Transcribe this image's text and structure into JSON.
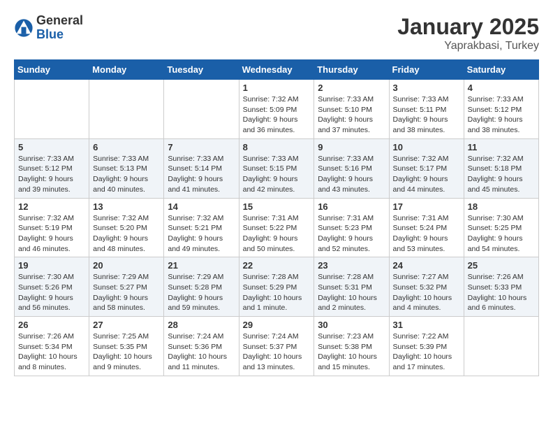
{
  "logo": {
    "general": "General",
    "blue": "Blue"
  },
  "title": "January 2025",
  "subtitle": "Yaprakbasi, Turkey",
  "days_of_week": [
    "Sunday",
    "Monday",
    "Tuesday",
    "Wednesday",
    "Thursday",
    "Friday",
    "Saturday"
  ],
  "weeks": [
    [
      {
        "num": "",
        "info": ""
      },
      {
        "num": "",
        "info": ""
      },
      {
        "num": "",
        "info": ""
      },
      {
        "num": "1",
        "info": "Sunrise: 7:32 AM\nSunset: 5:09 PM\nDaylight: 9 hours and 36 minutes."
      },
      {
        "num": "2",
        "info": "Sunrise: 7:33 AM\nSunset: 5:10 PM\nDaylight: 9 hours and 37 minutes."
      },
      {
        "num": "3",
        "info": "Sunrise: 7:33 AM\nSunset: 5:11 PM\nDaylight: 9 hours and 38 minutes."
      },
      {
        "num": "4",
        "info": "Sunrise: 7:33 AM\nSunset: 5:12 PM\nDaylight: 9 hours and 38 minutes."
      }
    ],
    [
      {
        "num": "5",
        "info": "Sunrise: 7:33 AM\nSunset: 5:12 PM\nDaylight: 9 hours and 39 minutes."
      },
      {
        "num": "6",
        "info": "Sunrise: 7:33 AM\nSunset: 5:13 PM\nDaylight: 9 hours and 40 minutes."
      },
      {
        "num": "7",
        "info": "Sunrise: 7:33 AM\nSunset: 5:14 PM\nDaylight: 9 hours and 41 minutes."
      },
      {
        "num": "8",
        "info": "Sunrise: 7:33 AM\nSunset: 5:15 PM\nDaylight: 9 hours and 42 minutes."
      },
      {
        "num": "9",
        "info": "Sunrise: 7:33 AM\nSunset: 5:16 PM\nDaylight: 9 hours and 43 minutes."
      },
      {
        "num": "10",
        "info": "Sunrise: 7:32 AM\nSunset: 5:17 PM\nDaylight: 9 hours and 44 minutes."
      },
      {
        "num": "11",
        "info": "Sunrise: 7:32 AM\nSunset: 5:18 PM\nDaylight: 9 hours and 45 minutes."
      }
    ],
    [
      {
        "num": "12",
        "info": "Sunrise: 7:32 AM\nSunset: 5:19 PM\nDaylight: 9 hours and 46 minutes."
      },
      {
        "num": "13",
        "info": "Sunrise: 7:32 AM\nSunset: 5:20 PM\nDaylight: 9 hours and 48 minutes."
      },
      {
        "num": "14",
        "info": "Sunrise: 7:32 AM\nSunset: 5:21 PM\nDaylight: 9 hours and 49 minutes."
      },
      {
        "num": "15",
        "info": "Sunrise: 7:31 AM\nSunset: 5:22 PM\nDaylight: 9 hours and 50 minutes."
      },
      {
        "num": "16",
        "info": "Sunrise: 7:31 AM\nSunset: 5:23 PM\nDaylight: 9 hours and 52 minutes."
      },
      {
        "num": "17",
        "info": "Sunrise: 7:31 AM\nSunset: 5:24 PM\nDaylight: 9 hours and 53 minutes."
      },
      {
        "num": "18",
        "info": "Sunrise: 7:30 AM\nSunset: 5:25 PM\nDaylight: 9 hours and 54 minutes."
      }
    ],
    [
      {
        "num": "19",
        "info": "Sunrise: 7:30 AM\nSunset: 5:26 PM\nDaylight: 9 hours and 56 minutes."
      },
      {
        "num": "20",
        "info": "Sunrise: 7:29 AM\nSunset: 5:27 PM\nDaylight: 9 hours and 58 minutes."
      },
      {
        "num": "21",
        "info": "Sunrise: 7:29 AM\nSunset: 5:28 PM\nDaylight: 9 hours and 59 minutes."
      },
      {
        "num": "22",
        "info": "Sunrise: 7:28 AM\nSunset: 5:29 PM\nDaylight: 10 hours and 1 minute."
      },
      {
        "num": "23",
        "info": "Sunrise: 7:28 AM\nSunset: 5:31 PM\nDaylight: 10 hours and 2 minutes."
      },
      {
        "num": "24",
        "info": "Sunrise: 7:27 AM\nSunset: 5:32 PM\nDaylight: 10 hours and 4 minutes."
      },
      {
        "num": "25",
        "info": "Sunrise: 7:26 AM\nSunset: 5:33 PM\nDaylight: 10 hours and 6 minutes."
      }
    ],
    [
      {
        "num": "26",
        "info": "Sunrise: 7:26 AM\nSunset: 5:34 PM\nDaylight: 10 hours and 8 minutes."
      },
      {
        "num": "27",
        "info": "Sunrise: 7:25 AM\nSunset: 5:35 PM\nDaylight: 10 hours and 9 minutes."
      },
      {
        "num": "28",
        "info": "Sunrise: 7:24 AM\nSunset: 5:36 PM\nDaylight: 10 hours and 11 minutes."
      },
      {
        "num": "29",
        "info": "Sunrise: 7:24 AM\nSunset: 5:37 PM\nDaylight: 10 hours and 13 minutes."
      },
      {
        "num": "30",
        "info": "Sunrise: 7:23 AM\nSunset: 5:38 PM\nDaylight: 10 hours and 15 minutes."
      },
      {
        "num": "31",
        "info": "Sunrise: 7:22 AM\nSunset: 5:39 PM\nDaylight: 10 hours and 17 minutes."
      },
      {
        "num": "",
        "info": ""
      }
    ]
  ]
}
